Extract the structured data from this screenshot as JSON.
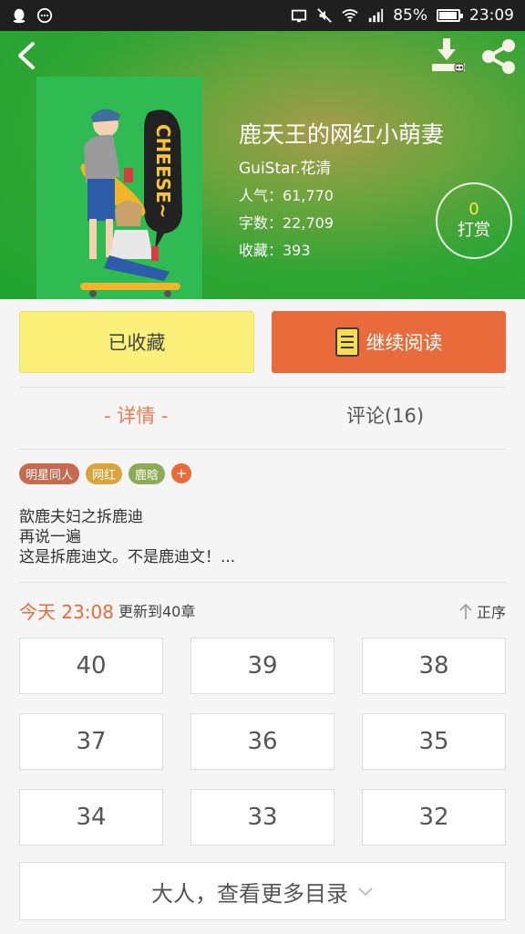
{
  "status_bar": {
    "battery": "85%",
    "battery_level": 0.85,
    "time": "23:09",
    "icons": [
      "qq-icon",
      "message-icon",
      "cast-icon",
      "mute-icon",
      "wifi-icon",
      "signal-icon",
      "battery-icon"
    ]
  },
  "header": {
    "book_title": "鹿天王的网红小萌妻",
    "author": "GuiStar.花清",
    "popularity": "人气：61,770",
    "word_count": "字数：22,709",
    "favorites": "收藏：393",
    "reward_count": "0",
    "reward_label": "打赏",
    "cover_text": "CHEESE~"
  },
  "actions": {
    "favorited_label": "已收藏",
    "continue_label": "继续阅读"
  },
  "tabs": {
    "detail": "- 详情 -",
    "comments": "评论(16)"
  },
  "tags": [
    {
      "label": "明星同人",
      "color": "#c56b52"
    },
    {
      "label": "网红",
      "color": "#d8a43b"
    },
    {
      "label": "鹿晗",
      "color": "#8dab55"
    }
  ],
  "tag_add": "+",
  "description": {
    "line1": "歆鹿夫妇之拆鹿迪",
    "line2": "再说一遍",
    "line3": "这是拆鹿迪文。不是鹿迪文！..."
  },
  "update": {
    "time": "今天 23:08",
    "text": "更新到40章",
    "sort_label": "正序"
  },
  "chapters": [
    "40",
    "39",
    "38",
    "37",
    "36",
    "35",
    "34",
    "33",
    "32"
  ],
  "more_button": "大人，查看更多目录",
  "colors": {
    "accent": "#e96a3a",
    "fav_button": "#fbf07a",
    "header_green": "#21a32f"
  }
}
